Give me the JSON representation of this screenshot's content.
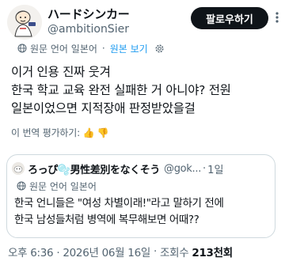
{
  "author": {
    "display_name": "ハードシンカー",
    "handle": "@ambitionSier"
  },
  "follow_button": {
    "label": "팔로우하기"
  },
  "translation_bar": {
    "source_label": "원문 언어 일본어",
    "separator": "·",
    "show_original": "원본 보기"
  },
  "tweet": {
    "lines": [
      "이거 인용 진짜 웃겨",
      "한국 학교 교육 완전 실패한 거 아니야? 전원",
      "일본이었으면 지적장애 판정받았을걸"
    ]
  },
  "rate_translation": "이 번역 평가하기: 👍 👎",
  "quote": {
    "display_name": "ろっぴ🫧男性差別をなくそう",
    "handle": "@gok...",
    "separator": "·",
    "time": "1일",
    "source_label": "원문 언어 일본어",
    "lines": [
      "한국 언니들은 \"여성 차별이래!\"라고 말하기 전에",
      "한국 남성들처럼 병역에 복무해보면 어때??"
    ]
  },
  "footer": {
    "time": "오후 6:36 · 2026년 06월 16일",
    "dot": "·",
    "views_label": "조회수",
    "views_count": "213천회"
  },
  "icons": {
    "avatar": "avatar-illustration",
    "more": "more-dots-icon",
    "globe": "globe-icon",
    "settings": "gear-icon",
    "quote_avatar": "avatar-icon"
  },
  "colors": {
    "text": "#0f1419",
    "muted": "#536471",
    "link": "#1d9bf0",
    "follow_bg": "#0f1419",
    "border": "#cfd9de"
  }
}
